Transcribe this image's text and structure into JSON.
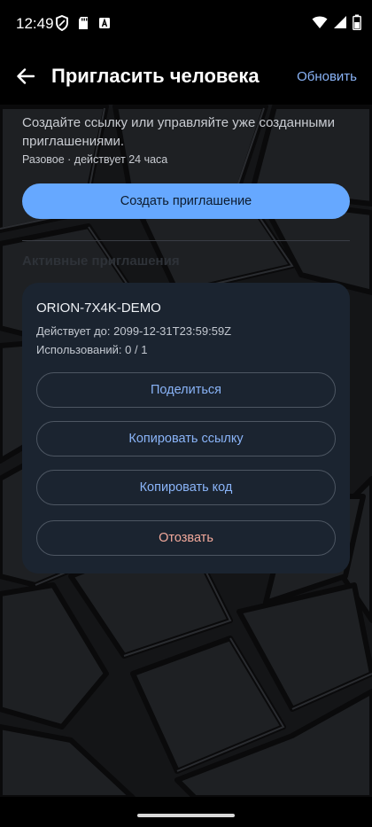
{
  "status_bar": {
    "time": "12:49",
    "left_icons": [
      "shield-icon",
      "sd-card-icon",
      "font-icon"
    ],
    "right_icons": [
      "wifi-icon",
      "signal-icon",
      "battery-icon"
    ]
  },
  "top_bar": {
    "back_icon": "arrow-left-icon",
    "title": "Пригласить человека",
    "refresh_label": "Обновить"
  },
  "intro": {
    "description": "Создайте ссылку или управляйте уже созданными приглашениями.",
    "subtitle": "Разовое · действует 24 часа",
    "create_button_label": "Создать приглашение"
  },
  "active_section": {
    "title": "Активные приглашения"
  },
  "invite_card": {
    "code": "ORION-7X4K-DEMO",
    "valid_until": "Действует до: 2099-12-31T23:59:59Z",
    "usage": "Использований: 0 / 1",
    "share_label": "Поделиться",
    "copy_link_label": "Копировать ссылку",
    "copy_code_label": "Копировать код",
    "revoke_label": "Отозвать"
  },
  "colors": {
    "accent": "#66a8ff",
    "link": "#8ab4f8",
    "danger": "#f2a99b",
    "card": "#1b2430"
  }
}
